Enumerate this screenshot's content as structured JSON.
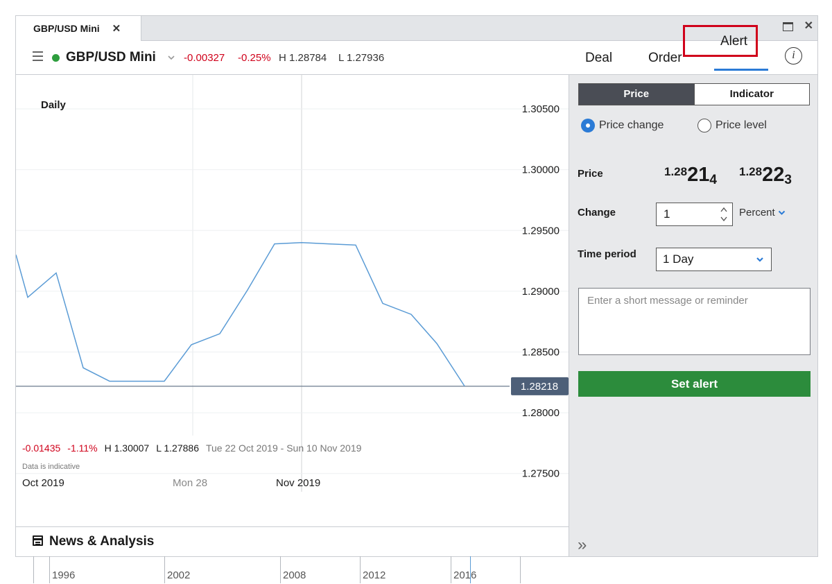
{
  "tab": {
    "title": "GBP/USD Mini",
    "close": "✕"
  },
  "window_controls": {
    "close": "✕"
  },
  "header": {
    "instrument": "GBP/USD Mini",
    "change": "-0.00327",
    "change_pct": "-0.25%",
    "high": "H 1.28784",
    "low": "L 1.27936",
    "tabs": {
      "deal": "Deal",
      "order": "Order",
      "alert": "Alert"
    },
    "info": "i"
  },
  "chart": {
    "period": "Daily",
    "current_price": "1.28218",
    "stats": {
      "change": "-0.01435",
      "change_pct": "-1.11%",
      "high": "H 1.30007",
      "low": "L 1.27886",
      "range": "Tue 22 Oct 2019 - Sun 10 Nov 2019"
    },
    "disclaimer": "Data is indicative",
    "x_labels": {
      "oct": "Oct 2019",
      "mon28": "Mon 28",
      "nov": "Nov 2019"
    },
    "timeline_years": [
      "1996",
      "2002",
      "2008",
      "2012",
      "2016"
    ]
  },
  "chart_data": {
    "type": "line",
    "series": [
      {
        "values": [
          1.293,
          1.2895,
          1.2915,
          1.2837,
          1.2826,
          1.2826,
          1.2826,
          1.2856,
          1.2865,
          1.2901,
          1.2939,
          1.294,
          1.2939,
          1.2938,
          1.289,
          1.2881,
          1.2857,
          1.2822
        ]
      }
    ],
    "y_ticks": [
      "1.30500",
      "1.30000",
      "1.29500",
      "1.29000",
      "1.28500",
      "1.28000",
      "1.27500"
    ],
    "ylim": [
      1.2735,
      1.3078
    ],
    "current_price_line": 1.28218,
    "grid": true,
    "accent": "#5a9bd5"
  },
  "news": {
    "label": "News & Analysis"
  },
  "alert_panel": {
    "segments": {
      "price": "Price",
      "indicator": "Indicator"
    },
    "radios": {
      "price_change": "Price change",
      "price_level": "Price level"
    },
    "price_label": "Price",
    "sell": {
      "small": "1.28",
      "big": "21",
      "sub": "4"
    },
    "buy": {
      "small": "1.28",
      "big": "22",
      "sub": "3"
    },
    "change_label": "Change",
    "change_value": "1",
    "change_unit": "Percent",
    "time_period_label": "Time period",
    "time_period_value": "1 Day",
    "message_placeholder": "Enter a short message or reminder",
    "set_alert": "Set alert",
    "expand": "»"
  }
}
